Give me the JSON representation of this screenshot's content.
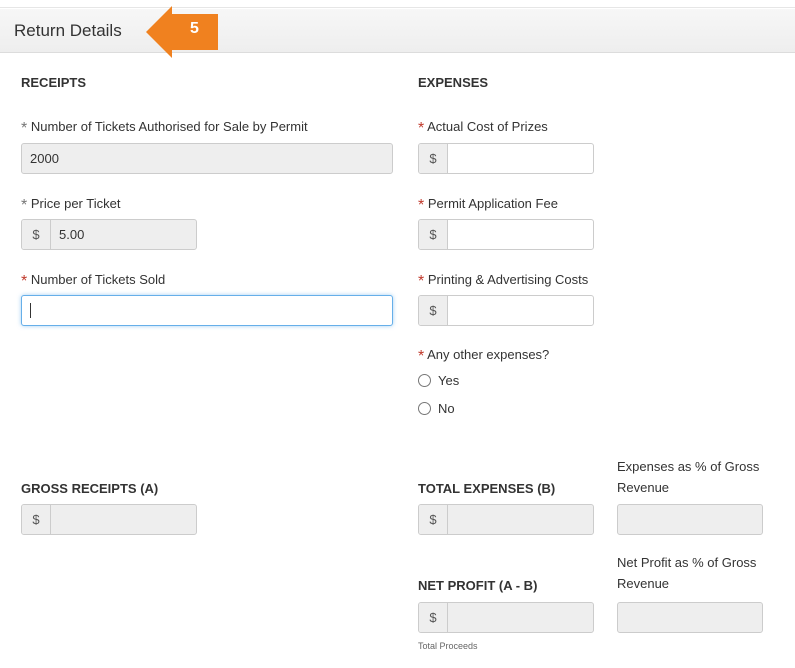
{
  "section": {
    "title": "Return Details",
    "step_number": "5",
    "step_color": "#f0811f"
  },
  "receipts": {
    "heading": "RECEIPTS",
    "tickets_authorised": {
      "label": "Number of Tickets Authorised for Sale by Permit",
      "required_mark": "*",
      "value": "2000"
    },
    "price_per_ticket": {
      "label": "Price per Ticket",
      "required_mark": "*",
      "currency": "$",
      "value": "5.00"
    },
    "tickets_sold": {
      "label": "Number of Tickets Sold",
      "required_mark": "*",
      "value": ""
    },
    "gross_receipts": {
      "label": "GROSS RECEIPTS (A)",
      "currency": "$",
      "value": ""
    }
  },
  "expenses": {
    "heading": "EXPENSES",
    "cost_of_prizes": {
      "label": "Actual Cost of Prizes",
      "required_mark": "*",
      "currency": "$",
      "value": ""
    },
    "permit_fee": {
      "label": "Permit Application Fee",
      "required_mark": "*",
      "currency": "$",
      "value": ""
    },
    "printing_costs": {
      "label": "Printing & Advertising Costs",
      "required_mark": "*",
      "currency": "$",
      "value": ""
    },
    "other_expenses": {
      "label": "Any other expenses?",
      "required_mark": "*",
      "options": [
        "Yes",
        "No"
      ]
    },
    "total_expenses": {
      "label": "TOTAL EXPENSES (B)",
      "currency": "$",
      "value": ""
    },
    "expenses_pct": {
      "label": "Expenses as % of Gross Revenue",
      "value": ""
    },
    "net_profit": {
      "label": "NET PROFIT (A - B)",
      "currency": "$",
      "value": "",
      "note": "Total Proceeds"
    },
    "net_profit_pct": {
      "label": "Net Profit as % of Gross Revenue",
      "value": ""
    }
  },
  "icons": {
    "step_marker": "left-arrow-badge",
    "radio": "radio-circle"
  },
  "colors": {
    "required": "#c0392b",
    "focus_border": "#66afe9",
    "readonly_bg": "#eeeeee"
  }
}
